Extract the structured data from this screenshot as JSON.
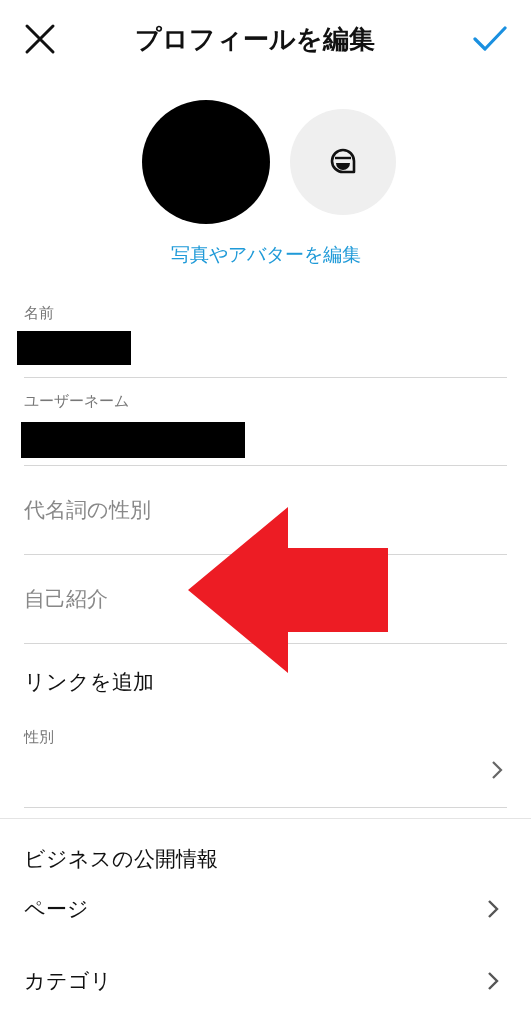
{
  "header": {
    "title": "プロフィールを編集"
  },
  "profile": {
    "edit_photo_link": "写真やアバターを編集"
  },
  "fields": [
    {
      "kind": "filled",
      "label": "名前",
      "redacted": true
    },
    {
      "kind": "filled",
      "label": "ユーザーネーム",
      "redacted": true
    },
    {
      "kind": "placeholder",
      "placeholder": "代名詞の性別"
    },
    {
      "kind": "placeholder",
      "placeholder": "自己紹介"
    },
    {
      "kind": "link",
      "text": "リンクを追加"
    },
    {
      "kind": "select",
      "label": "性別"
    }
  ],
  "business": {
    "title": "ビジネスの公開情報",
    "items": [
      {
        "label": "ページ"
      },
      {
        "label": "カテゴリ"
      }
    ]
  },
  "annotation": {
    "kind": "arrow",
    "color": "#ed1c24"
  }
}
